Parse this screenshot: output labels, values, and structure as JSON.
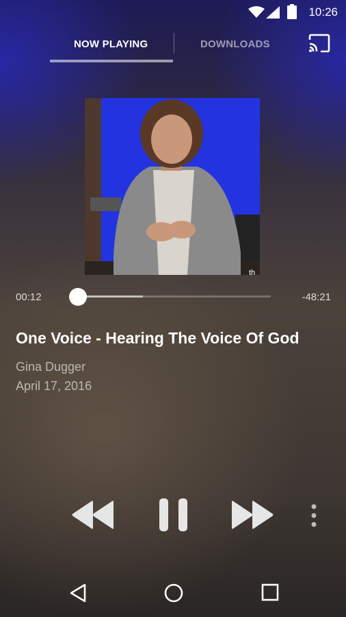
{
  "status_bar": {
    "time": "10:26",
    "icons": [
      "wifi-icon",
      "signal-icon",
      "battery-icon"
    ]
  },
  "tabs": [
    {
      "label": "NOW PLAYING",
      "active": true
    },
    {
      "label": "DOWNLOADS",
      "active": false
    }
  ],
  "toolbar": {
    "cast_icon": "cast-icon"
  },
  "player": {
    "elapsed": "00:12",
    "remaining": "-48:21",
    "progress_fraction": 0.004,
    "buffered_fraction": 0.34
  },
  "episode": {
    "title": "One Voice - Hearing The Voice Of God",
    "speaker": "Gina Dugger",
    "date": "April 17, 2016"
  },
  "controls": [
    "rewind-icon",
    "pause-icon",
    "fast-forward-icon",
    "more-vert-icon"
  ],
  "nav": [
    "back-icon",
    "home-icon",
    "recents-icon"
  ],
  "colors": {
    "accent": "#ffffff",
    "artwork_background": "#1e2ad8"
  }
}
